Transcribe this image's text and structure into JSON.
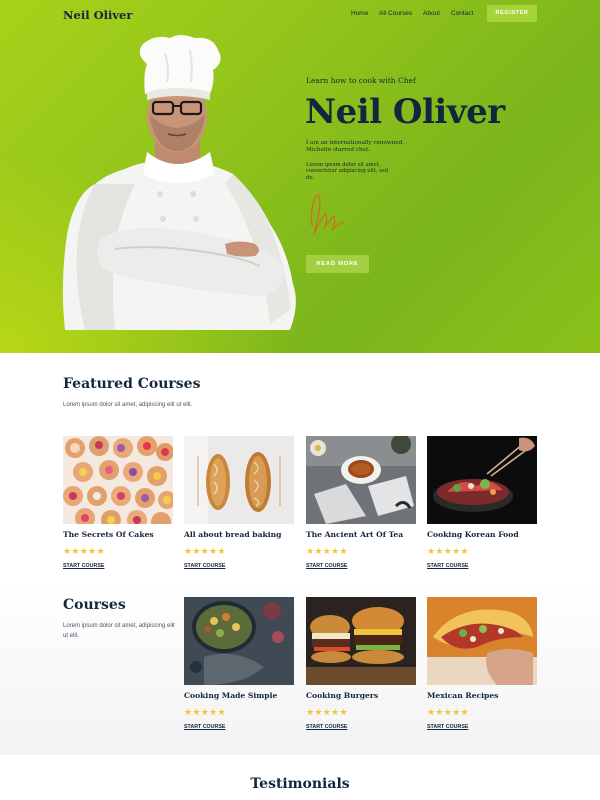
{
  "nav": {
    "logo": "Neil Oliver",
    "links": [
      "Home",
      "All Courses",
      "About",
      "Contact"
    ],
    "register": "REGISTER"
  },
  "hero": {
    "eyebrow": "Learn how to cook with Chef",
    "name": "Neil Oliver",
    "intro": "I am an internationally renowned, Michelin starred chef.",
    "lorem": "Lorem ipsum dolor sit amet, consectetur adipiscing elit, sed do.",
    "button": "READ MORE"
  },
  "featured": {
    "title": "Featured Courses",
    "subtitle": "Lorem ipsum dolor sit amet, adipiscing elit ut elit.",
    "cards": [
      {
        "title": "The Secrets Of Cakes",
        "stars": "★★★★★",
        "link": "START COURSE"
      },
      {
        "title": "All about bread baking",
        "stars": "★★★★★",
        "link": "START COURSE"
      },
      {
        "title": "The Ancient Art Of Tea",
        "stars": "★★★★★",
        "link": "START COURSE"
      },
      {
        "title": "Cooking Korean Food",
        "stars": "★★★★★",
        "link": "START COURSE"
      }
    ]
  },
  "courses": {
    "title": "Courses",
    "subtitle": "Lorem ipsum dolor sit amet, adipiscing elit ut elit.",
    "cards": [
      {
        "title": "Cooking Made Simple",
        "stars": "★★★★★",
        "link": "START COURSE"
      },
      {
        "title": "Cooking Burgers",
        "stars": "★★★★★",
        "link": "START COURSE"
      },
      {
        "title": "Mexican Recipes",
        "stars": "★★★★★",
        "link": "START COURSE"
      }
    ]
  },
  "testimonials": {
    "title": "Testimonials"
  },
  "colors": {
    "navy": "#14263d",
    "lime": "#8fc21b",
    "star": "#f3c33a",
    "button": "#a3d043"
  }
}
